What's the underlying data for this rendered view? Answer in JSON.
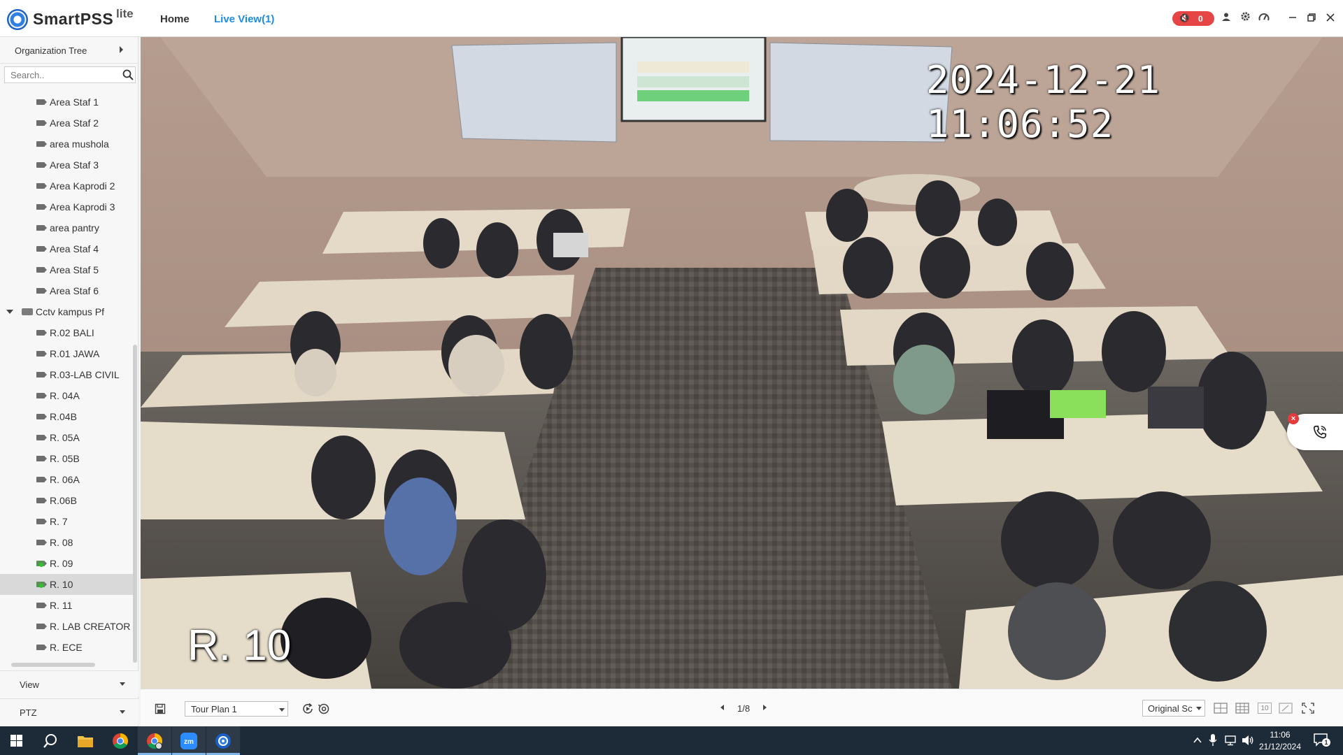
{
  "app": {
    "brand": "SmartPSS",
    "brand_suffix": "lite",
    "nav": {
      "home": "Home",
      "live_view": "Live View(1)"
    },
    "alarm_count": "0"
  },
  "sidebar": {
    "org_tree_label": "Organization Tree",
    "search_placeholder": "Search..",
    "tree": [
      {
        "label": "Area Staf 1",
        "type": "camera"
      },
      {
        "label": "Area Staf 2",
        "type": "camera"
      },
      {
        "label": "area mushola",
        "type": "camera"
      },
      {
        "label": "Area Staf 3",
        "type": "camera"
      },
      {
        "label": "Area Kaprodi 2",
        "type": "camera"
      },
      {
        "label": "Area Kaprodi 3",
        "type": "camera"
      },
      {
        "label": "area pantry",
        "type": "camera"
      },
      {
        "label": "Area Staf 4",
        "type": "camera"
      },
      {
        "label": "Area Staf 5",
        "type": "camera"
      },
      {
        "label": "Area Staf 6",
        "type": "camera"
      },
      {
        "label": "Cctv kampus Pf",
        "type": "group"
      },
      {
        "label": "R.02 BALI",
        "type": "camera"
      },
      {
        "label": "R.01 JAWA",
        "type": "camera"
      },
      {
        "label": "R.03-LAB CIVIL",
        "type": "camera"
      },
      {
        "label": "R. 04A",
        "type": "camera"
      },
      {
        "label": "R.04B",
        "type": "camera"
      },
      {
        "label": "R. 05A",
        "type": "camera"
      },
      {
        "label": "R. 05B",
        "type": "camera"
      },
      {
        "label": "R. 06A",
        "type": "camera"
      },
      {
        "label": "R.06B",
        "type": "camera"
      },
      {
        "label": "R. 7",
        "type": "camera"
      },
      {
        "label": "R. 08",
        "type": "camera"
      },
      {
        "label": "R. 09",
        "type": "camera",
        "live": true
      },
      {
        "label": "R. 10",
        "type": "camera",
        "live": true,
        "selected": true
      },
      {
        "label": "R. 11",
        "type": "camera"
      },
      {
        "label": "R. LAB CREATOR",
        "type": "camera"
      },
      {
        "label": "R. ECE",
        "type": "camera"
      }
    ],
    "panels": {
      "view": "View",
      "ptz": "PTZ"
    }
  },
  "video": {
    "osd_timestamp": "2024-12-21  11:06:52",
    "osd_channel": "R. 10"
  },
  "toolbar": {
    "tour_plan": "Tour Plan 1",
    "page_indicator": "1/8",
    "scale_mode": "Original Sc",
    "split_10_label": "10"
  },
  "taskbar": {
    "time": "11:06",
    "date": "21/12/2024",
    "notification_count": "1"
  },
  "colors": {
    "accent": "#1d8ce8",
    "alarm": "#e64545",
    "taskbar": "#1d2a38",
    "live_indicator": "#2cc52c"
  }
}
